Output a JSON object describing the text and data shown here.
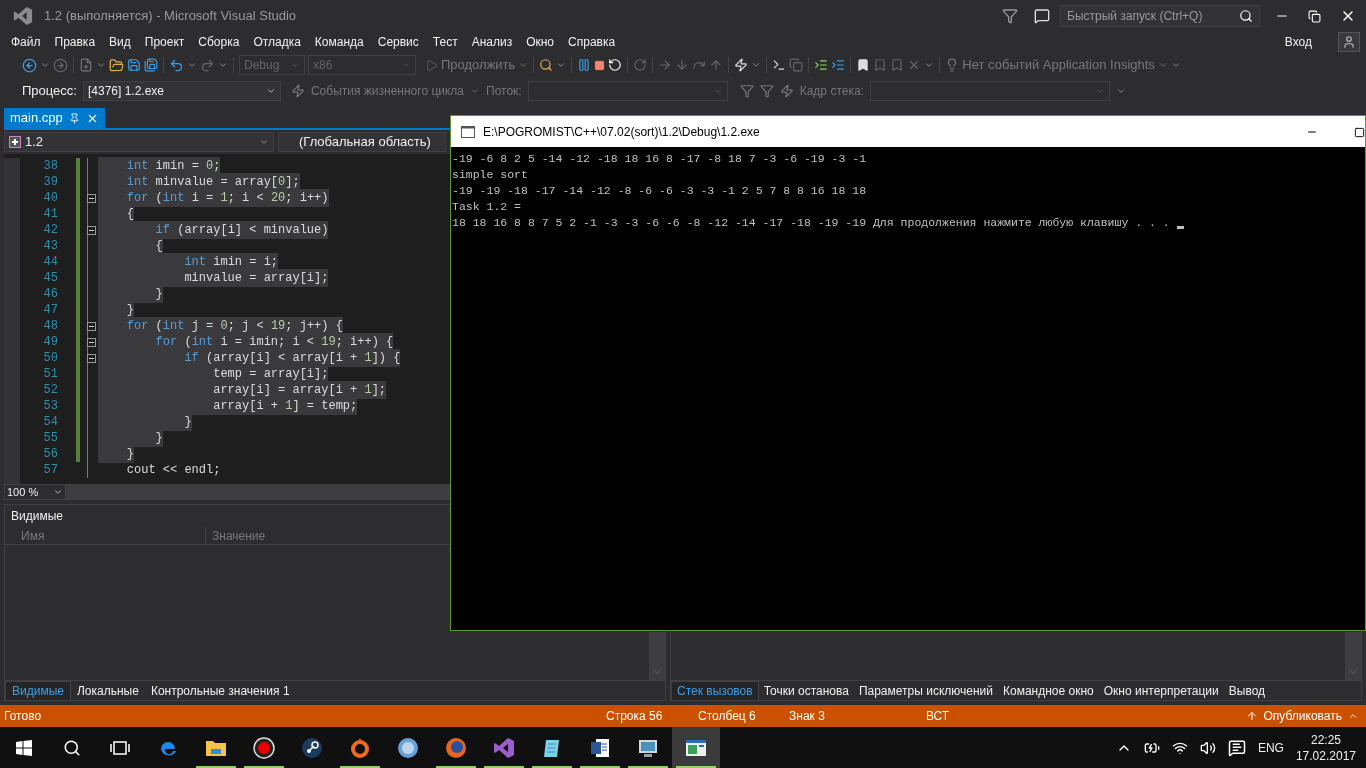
{
  "window": {
    "title": "1.2 (выполняется) - Microsoft Visual Studio"
  },
  "quick_launch": {
    "placeholder": "Быстрый запуск (Ctrl+Q)"
  },
  "menu": [
    "Файл",
    "Правка",
    "Вид",
    "Проект",
    "Сборка",
    "Отладка",
    "Команда",
    "Сервис",
    "Тест",
    "Анализ",
    "Окно",
    "Справка"
  ],
  "sign_in": "Вход",
  "toolbar": {
    "configuration": {
      "value": "Debug",
      "disabled": true
    },
    "platform": {
      "value": "x86",
      "disabled": true
    },
    "continue": "Продолжить",
    "insights": "Нет событий Application Insights"
  },
  "debug_location": {
    "process_label": "Процесс:",
    "process": "[4376] 1.2.exe",
    "lifecycle": "События жизненного цикла",
    "thread_label": "Поток:",
    "stack_frame_label": "Кадр стека:"
  },
  "editor": {
    "tab": {
      "title": "main.cpp",
      "selected": true
    },
    "project": "1.2",
    "scope": "(Глобальная область)",
    "zoom": "100 %",
    "lines": [
      {
        "number": "38",
        "changed": true,
        "selected": true,
        "fold": false,
        "tokens": [
          {
            "kind": "keyword",
            "text": "    int"
          },
          {
            "kind": "plain",
            "text": " imin = "
          },
          {
            "kind": "number",
            "text": "0"
          },
          {
            "kind": "plain",
            "text": ";"
          }
        ]
      },
      {
        "number": "39",
        "changed": true,
        "selected": true,
        "fold": false,
        "tokens": [
          {
            "kind": "keyword",
            "text": "    int"
          },
          {
            "kind": "plain",
            "text": " minvalue = array["
          },
          {
            "kind": "number",
            "text": "0"
          },
          {
            "kind": "plain",
            "text": "];"
          }
        ]
      },
      {
        "number": "40",
        "changed": true,
        "selected": true,
        "fold": true,
        "tokens": [
          {
            "kind": "keyword",
            "text": "    for"
          },
          {
            "kind": "plain",
            "text": " ("
          },
          {
            "kind": "keyword",
            "text": "int"
          },
          {
            "kind": "plain",
            "text": " i = "
          },
          {
            "kind": "number",
            "text": "1"
          },
          {
            "kind": "plain",
            "text": "; i < "
          },
          {
            "kind": "number",
            "text": "20"
          },
          {
            "kind": "plain",
            "text": "; i++)"
          }
        ]
      },
      {
        "number": "41",
        "changed": true,
        "selected": true,
        "fold": false,
        "tokens": [
          {
            "kind": "plain",
            "text": "    {"
          }
        ]
      },
      {
        "number": "42",
        "changed": true,
        "selected": true,
        "fold": true,
        "tokens": [
          {
            "kind": "keyword",
            "text": "        if"
          },
          {
            "kind": "plain",
            "text": " (array[i] < minvalue)"
          }
        ]
      },
      {
        "number": "43",
        "changed": true,
        "selected": true,
        "fold": false,
        "tokens": [
          {
            "kind": "plain",
            "text": "        {"
          }
        ]
      },
      {
        "number": "44",
        "changed": true,
        "selected": true,
        "fold": false,
        "tokens": [
          {
            "kind": "keyword",
            "text": "            int"
          },
          {
            "kind": "plain",
            "text": " imin = i;"
          }
        ]
      },
      {
        "number": "45",
        "changed": true,
        "selected": true,
        "fold": false,
        "tokens": [
          {
            "kind": "plain",
            "text": "            minvalue = array[i];"
          }
        ]
      },
      {
        "number": "46",
        "changed": true,
        "selected": true,
        "fold": false,
        "tokens": [
          {
            "kind": "plain",
            "text": "        }"
          }
        ]
      },
      {
        "number": "47",
        "changed": true,
        "selected": true,
        "fold": false,
        "tokens": [
          {
            "kind": "plain",
            "text": "    }"
          }
        ]
      },
      {
        "number": "48",
        "changed": true,
        "selected": true,
        "fold": true,
        "tokens": [
          {
            "kind": "keyword",
            "text": "    for"
          },
          {
            "kind": "plain",
            "text": " ("
          },
          {
            "kind": "keyword",
            "text": "int"
          },
          {
            "kind": "plain",
            "text": " j = "
          },
          {
            "kind": "number",
            "text": "0"
          },
          {
            "kind": "plain",
            "text": "; j < "
          },
          {
            "kind": "number",
            "text": "19"
          },
          {
            "kind": "plain",
            "text": "; j++) {"
          }
        ]
      },
      {
        "number": "49",
        "changed": true,
        "selected": true,
        "fold": true,
        "tokens": [
          {
            "kind": "keyword",
            "text": "        for"
          },
          {
            "kind": "plain",
            "text": " ("
          },
          {
            "kind": "keyword",
            "text": "int"
          },
          {
            "kind": "plain",
            "text": " i = imin; i < "
          },
          {
            "kind": "number",
            "text": "19"
          },
          {
            "kind": "plain",
            "text": "; i++) {"
          }
        ]
      },
      {
        "number": "50",
        "changed": true,
        "selected": true,
        "fold": true,
        "tokens": [
          {
            "kind": "keyword",
            "text": "            if"
          },
          {
            "kind": "plain",
            "text": " (array[i] < array[i + "
          },
          {
            "kind": "number",
            "text": "1"
          },
          {
            "kind": "plain",
            "text": "]) {"
          }
        ]
      },
      {
        "number": "51",
        "changed": true,
        "selected": true,
        "fold": false,
        "tokens": [
          {
            "kind": "plain",
            "text": "                temp = array[i];"
          }
        ]
      },
      {
        "number": "52",
        "changed": true,
        "selected": true,
        "fold": false,
        "tokens": [
          {
            "kind": "plain",
            "text": "                array[i] = array[i + "
          },
          {
            "kind": "number",
            "text": "1"
          },
          {
            "kind": "plain",
            "text": "];"
          }
        ]
      },
      {
        "number": "53",
        "changed": true,
        "selected": true,
        "fold": false,
        "tokens": [
          {
            "kind": "plain",
            "text": "                array[i + "
          },
          {
            "kind": "number",
            "text": "1"
          },
          {
            "kind": "plain",
            "text": "] = temp;"
          }
        ]
      },
      {
        "number": "54",
        "changed": true,
        "selected": true,
        "fold": false,
        "tokens": [
          {
            "kind": "plain",
            "text": "            }"
          }
        ]
      },
      {
        "number": "55",
        "changed": true,
        "selected": true,
        "fold": false,
        "tokens": [
          {
            "kind": "plain",
            "text": "        }"
          }
        ]
      },
      {
        "number": "56",
        "changed": true,
        "selected": true,
        "fold": false,
        "tokens": [
          {
            "kind": "plain",
            "text": "    }"
          }
        ]
      },
      {
        "number": "57",
        "changed": false,
        "selected": false,
        "fold": false,
        "tokens": [
          {
            "kind": "plain",
            "text": "    cout << endl;"
          }
        ]
      }
    ]
  },
  "console": {
    "title": "E:\\POGROMIST\\C++\\07.02(sort)\\1.2\\Debug\\1.2.exe",
    "cursor": true,
    "lines": [
      "-19 -6 8 2 5 -14 -12 -18 18 16 8 -17 -8 18 7 -3 -6 -19 -3 -1",
      "simple sort",
      "-19 -19 -18 -17 -14 -12 -8 -6 -6 -3 -3 -1 2 5 7 8 8 16 18 18",
      "Task 1.2 =",
      "18 18 16 8 8 7 5 2 -1 -3 -3 -6 -6 -8 -12 -14 -17 -18 -19 -19 Для продолжения нажмите любую клавишу . . ."
    ]
  },
  "watch_panel": {
    "title": "Видимые",
    "columns": [
      "Имя",
      "Значение"
    ],
    "tabs": [
      {
        "label": "Видимые",
        "selected": true
      },
      {
        "label": "Локальные",
        "selected": false
      },
      {
        "label": "Контрольные значения 1",
        "selected": false
      }
    ]
  },
  "call_stack_panel": {
    "tabs": [
      {
        "label": "Стек вызовов",
        "selected": true
      },
      {
        "label": "Точки останова",
        "selected": false
      },
      {
        "label": "Параметры исключений",
        "selected": false
      },
      {
        "label": "Командное окно",
        "selected": false
      },
      {
        "label": "Окно интерпретации",
        "selected": false
      },
      {
        "label": "Вывод",
        "selected": false
      }
    ]
  },
  "status_bar": {
    "message": "Готово",
    "line": "Строка 56",
    "column": "Столбец 6",
    "char": "Знак 3",
    "mode": "ВСТ",
    "publish": "Опубликовать"
  },
  "taskbar": {
    "apps": [
      {
        "kind": "start",
        "running": false,
        "active": false
      },
      {
        "kind": "search",
        "running": false,
        "active": false
      },
      {
        "kind": "taskview",
        "running": false,
        "active": false
      },
      {
        "kind": "browser",
        "running": false,
        "active": false
      },
      {
        "kind": "folder",
        "running": true,
        "active": false
      },
      {
        "kind": "record",
        "running": true,
        "active": false
      },
      {
        "kind": "wheel",
        "running": false,
        "active": false
      },
      {
        "kind": "ring",
        "running": true,
        "active": false
      },
      {
        "kind": "disc",
        "running": false,
        "active": false
      },
      {
        "kind": "globe",
        "running": true,
        "active": false
      },
      {
        "kind": "ribbon",
        "running": true,
        "active": false
      },
      {
        "kind": "notepad",
        "running": true,
        "active": false
      },
      {
        "kind": "document",
        "running": true,
        "active": false
      },
      {
        "kind": "monitor",
        "running": true,
        "active": false
      },
      {
        "kind": "window",
        "running": true,
        "active": true
      }
    ],
    "language": "ENG",
    "time": "22:25",
    "date": "17.02.2017"
  }
}
